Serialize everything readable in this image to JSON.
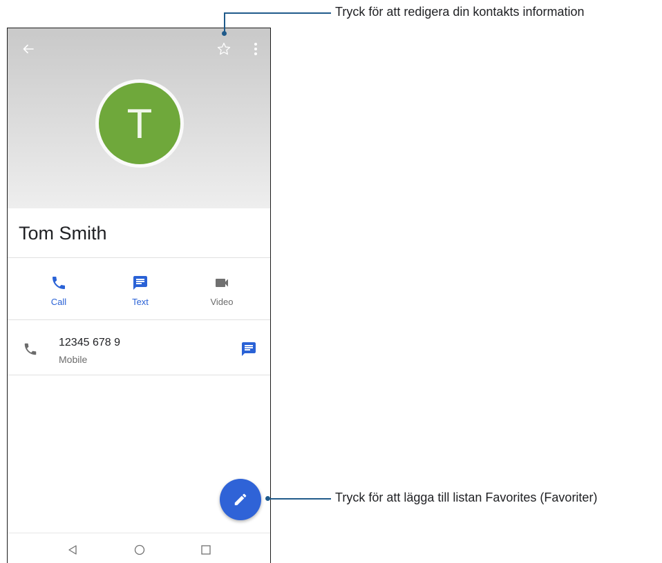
{
  "contact": {
    "avatar_letter": "T",
    "name": "Tom Smith",
    "avatar_color": "#6fa83b"
  },
  "actions": [
    {
      "label": "Call",
      "icon": "phone-icon"
    },
    {
      "label": "Text",
      "icon": "message-icon"
    },
    {
      "label": "Video",
      "icon": "video-icon"
    }
  ],
  "phone_entry": {
    "number": "12345 678 9",
    "type": "Mobile"
  },
  "callouts": {
    "top": "Tryck för att redigera din kontakts information",
    "bottom": "Tryck för att lägga till listan Favorites (Favoriter)"
  },
  "colors": {
    "accent": "#2f63d7",
    "callout_line": "#1f5a8a"
  },
  "icons": {
    "back": "arrow-back-icon",
    "favorite": "star-outline-icon",
    "more": "more-vert-icon",
    "fab": "edit-pencil-icon",
    "nav": [
      "nav-back-icon",
      "nav-home-icon",
      "nav-recents-icon"
    ]
  }
}
